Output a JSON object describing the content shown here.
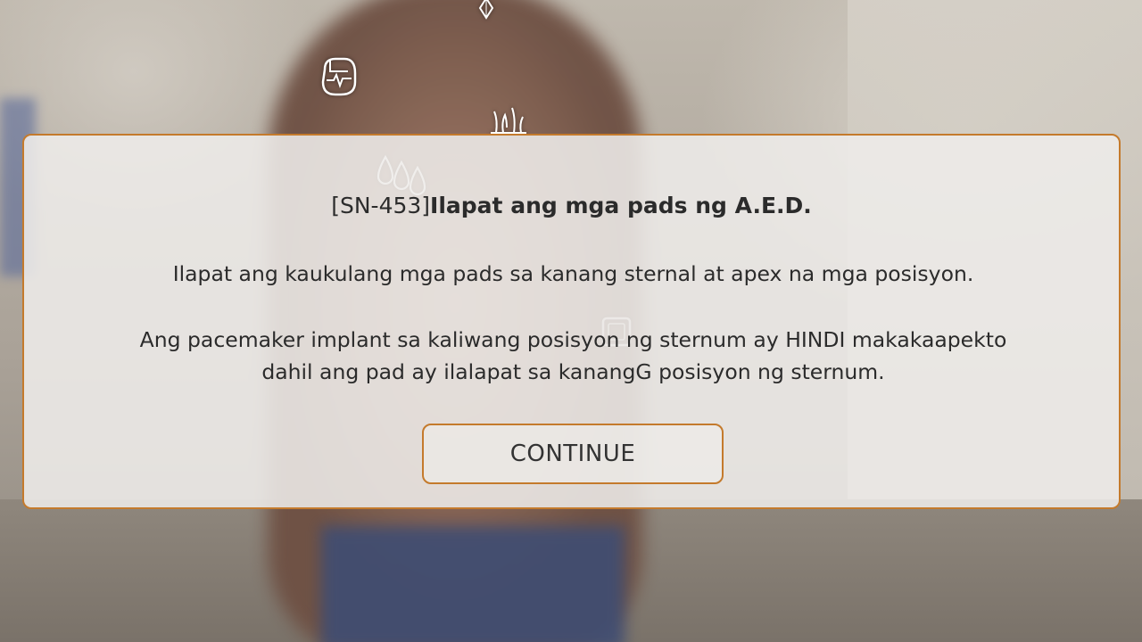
{
  "dialog": {
    "code": "[SN-453]",
    "title": "Ilapat ang mga pads ng A.E.D.",
    "paragraph1": "Ilapat ang kaukulang mga pads sa kanang sternal at apex na mga posisyon.",
    "paragraph2_line1": "Ang pacemaker implant sa kaliwang posisyon ng sternum ay HINDI makakaapekto",
    "paragraph2_line2": "dahil ang pad ay ilalapat sa kanangG posisyon ng sternum.",
    "continue_label": "CONTINUE"
  },
  "icons": [
    "diamond-icon",
    "heart-monitor-icon",
    "hair-icon",
    "sweat-drops-icon",
    "square-marker-icon"
  ],
  "colors": {
    "accent_border": "#c47a2c",
    "panel_background": "#eeece9",
    "text": "#2b2b2b"
  }
}
